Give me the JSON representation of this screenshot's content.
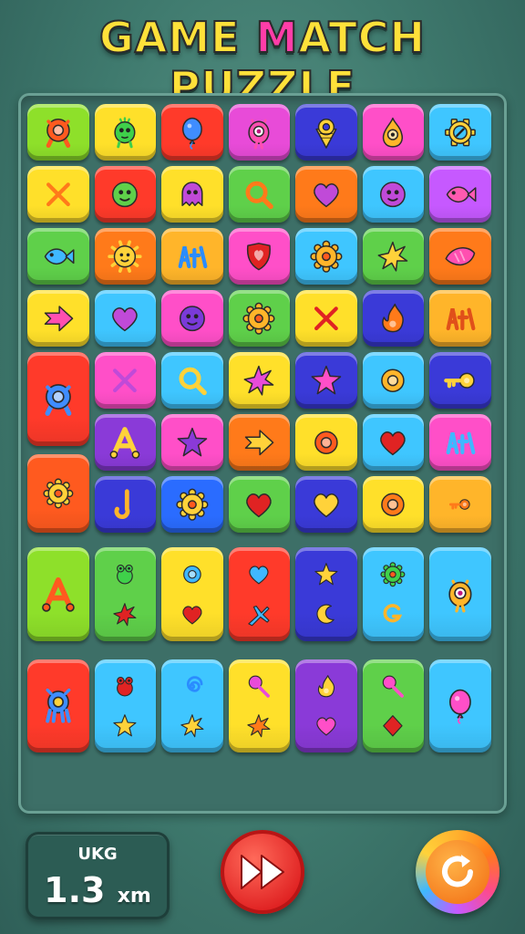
{
  "title": {
    "part1": "GAME ",
    "part2": "M",
    "part3": "ATCH PUZZLE"
  },
  "hud": {
    "label": "UKG",
    "value": "1.3",
    "unit": "xm"
  },
  "tiles": [
    {
      "r": 0,
      "c": 0,
      "color": "#8ee02a",
      "icon": "ring-creature-icon",
      "ic": "#ff5a1f"
    },
    {
      "r": 0,
      "c": 1,
      "color": "#ffe02a",
      "icon": "alien-creature-icon",
      "ic": "#3fd04a"
    },
    {
      "r": 0,
      "c": 2,
      "color": "#ff3a2a",
      "icon": "balloon-creature-icon",
      "ic": "#3f8dff"
    },
    {
      "r": 0,
      "c": 3,
      "color": "#e84bd8",
      "icon": "eye-creature-icon",
      "ic": "#ff4fb0"
    },
    {
      "r": 0,
      "c": 4,
      "color": "#3a3ad8",
      "icon": "cone-creature-icon",
      "ic": "#ffd23a"
    },
    {
      "r": 0,
      "c": 5,
      "color": "#ff4fc8",
      "icon": "flame-creature-icon",
      "ic": "#ffb52a"
    },
    {
      "r": 0,
      "c": 6,
      "color": "#3fc6ff",
      "icon": "gear-compass-icon",
      "ic": "#ffd23a"
    },
    {
      "r": 1,
      "c": 0,
      "color": "#ffe02a",
      "icon": "cross-icon",
      "ic": "#ff7a1a"
    },
    {
      "r": 1,
      "c": 1,
      "color": "#ff3a2a",
      "icon": "face-icon",
      "ic": "#5fd04a"
    },
    {
      "r": 1,
      "c": 2,
      "color": "#ffe02a",
      "icon": "ghost-icon",
      "ic": "#c04ad8"
    },
    {
      "r": 1,
      "c": 3,
      "color": "#5fd04a",
      "icon": "magnifier-icon",
      "ic": "#ff7a1a"
    },
    {
      "r": 1,
      "c": 4,
      "color": "#ff7a1a",
      "icon": "heart-icon",
      "ic": "#c04ad8"
    },
    {
      "r": 1,
      "c": 5,
      "color": "#3fc6ff",
      "icon": "face-icon",
      "ic": "#c04ad8"
    },
    {
      "r": 1,
      "c": 6,
      "color": "#c659ff",
      "icon": "fish-icon",
      "ic": "#ff5ab0"
    },
    {
      "r": 2,
      "c": 0,
      "color": "#5fd04a",
      "icon": "fish-icon",
      "ic": "#3fb8ff"
    },
    {
      "r": 2,
      "c": 1,
      "color": "#ff7a1a",
      "icon": "sun-face-icon",
      "ic": "#ffd23a"
    },
    {
      "r": 2,
      "c": 2,
      "color": "#ffb52a",
      "icon": "letters-icon",
      "ic": "#2a8cff"
    },
    {
      "r": 2,
      "c": 3,
      "color": "#ff4fc8",
      "icon": "shield-heart-icon",
      "ic": "#e02323"
    },
    {
      "r": 2,
      "c": 4,
      "color": "#3fc6ff",
      "icon": "gear-icon",
      "ic": "#ffb52a"
    },
    {
      "r": 2,
      "c": 5,
      "color": "#5fd04a",
      "icon": "star-burst-icon",
      "ic": "#ffd23a"
    },
    {
      "r": 2,
      "c": 6,
      "color": "#ff7a1a",
      "icon": "leaf-icon",
      "ic": "#ff4fb0"
    },
    {
      "r": 3,
      "c": 0,
      "color": "#ffe02a",
      "icon": "arrow-icon",
      "ic": "#ff4fb0"
    },
    {
      "r": 3,
      "c": 1,
      "color": "#3fc6ff",
      "icon": "heart-icon",
      "ic": "#c04ad8"
    },
    {
      "r": 3,
      "c": 2,
      "color": "#ff4fc8",
      "icon": "blob-face-icon",
      "ic": "#7a3ad8"
    },
    {
      "r": 3,
      "c": 3,
      "color": "#5fd04a",
      "icon": "gear-icon",
      "ic": "#ffb52a"
    },
    {
      "r": 3,
      "c": 4,
      "color": "#ffe02a",
      "icon": "cross-icon",
      "ic": "#e02323"
    },
    {
      "r": 3,
      "c": 5,
      "color": "#3a3ad8",
      "icon": "flame-icon",
      "ic": "#ff7a1a"
    },
    {
      "r": 3,
      "c": 6,
      "color": "#ffb52a",
      "icon": "letters-icon",
      "ic": "#e0501a"
    },
    {
      "r": 4,
      "c": 1,
      "color": "#ff4fc8",
      "icon": "cross-icon",
      "ic": "#c04ad8"
    },
    {
      "r": 4,
      "c": 2,
      "color": "#3fc6ff",
      "icon": "magnifier-icon",
      "ic": "#ffd23a"
    },
    {
      "r": 4,
      "c": 3,
      "color": "#ffe02a",
      "icon": "star-burst-icon",
      "ic": "#e84bd8"
    },
    {
      "r": 4,
      "c": 4,
      "color": "#3a3ad8",
      "icon": "star-icon",
      "ic": "#ff4fc8"
    },
    {
      "r": 4,
      "c": 5,
      "color": "#3fc6ff",
      "icon": "ring-icon",
      "ic": "#ffb52a"
    },
    {
      "r": 4,
      "c": 6,
      "color": "#3a3ad8",
      "icon": "key-icon",
      "ic": "#ffd23a"
    },
    {
      "r": 5,
      "c": 1,
      "color": "#8a3ad8",
      "icon": "letter-a-icon",
      "ic": "#ffd23a"
    },
    {
      "r": 5,
      "c": 2,
      "color": "#ff4fc8",
      "icon": "star-icon",
      "ic": "#8a3ad8"
    },
    {
      "r": 5,
      "c": 3,
      "color": "#ff7a1a",
      "icon": "arrow-icon",
      "ic": "#ffd23a"
    },
    {
      "r": 5,
      "c": 4,
      "color": "#ffe02a",
      "icon": "ring-icon",
      "ic": "#ff5a1f"
    },
    {
      "r": 5,
      "c": 5,
      "color": "#3fc6ff",
      "icon": "heart-icon",
      "ic": "#e02323"
    },
    {
      "r": 5,
      "c": 6,
      "color": "#ff4fc8",
      "icon": "letters-icon",
      "ic": "#3fb8ff"
    },
    {
      "r": 6,
      "c": 1,
      "color": "#3a3ad8",
      "icon": "hook-icon",
      "ic": "#ffb52a"
    },
    {
      "r": 6,
      "c": 2,
      "color": "#2a6cff",
      "icon": "gear-icon",
      "ic": "#ffd23a"
    },
    {
      "r": 6,
      "c": 3,
      "color": "#5fd04a",
      "icon": "heart-icon",
      "ic": "#e02323"
    },
    {
      "r": 6,
      "c": 4,
      "color": "#3a3ad8",
      "icon": "heart-icon",
      "ic": "#ffd23a"
    },
    {
      "r": 6,
      "c": 5,
      "color": "#ffe02a",
      "icon": "ring-icon",
      "ic": "#ff7a1a"
    }
  ],
  "bigTiles": [
    {
      "r": 4,
      "c": 0,
      "rows": 1.6,
      "color": "#ff3a2a",
      "icon": "ring-creature-icon",
      "ic": "#3f8dff"
    },
    {
      "r": 5.65,
      "c": 0,
      "rows": 1.35,
      "color": "#ff5a1f",
      "icon": "gear-icon",
      "ic": "#ffd23a"
    },
    {
      "r": 6,
      "c": 6,
      "rows": 1,
      "color": "#ffb52a",
      "icon": "key-icon",
      "ic": "#ff7a1a"
    },
    {
      "r": 7.15,
      "c": 0,
      "rows": 1.6,
      "color": "#8ee02a",
      "icon": "letter-a-icon",
      "ic": "#ff5a1f"
    },
    {
      "r": 7.15,
      "c": 6,
      "rows": 1.6,
      "color": "#3fc6ff",
      "icon": "eye-creature-icon",
      "ic": "#ffb52a"
    },
    {
      "r": 8.95,
      "c": 0,
      "rows": 1.6,
      "color": "#ff3a2a",
      "icon": "squid-icon",
      "ic": "#3f8dff"
    },
    {
      "r": 8.95,
      "c": 6,
      "rows": 1.6,
      "color": "#3fc6ff",
      "icon": "balloon-creature-icon",
      "ic": "#ff4fc8"
    }
  ],
  "twinTiles": [
    {
      "r": 7.15,
      "c": 1,
      "color": "#5fd04a",
      "icons": [
        "frog-icon",
        "star-burst-icon"
      ],
      "ic": [
        "#3fd04a",
        "#e02323"
      ]
    },
    {
      "r": 7.15,
      "c": 2,
      "color": "#ffe02a",
      "icons": [
        "ring-icon",
        "heart-icon"
      ],
      "ic": [
        "#3fb8ff",
        "#e02323"
      ]
    },
    {
      "r": 7.15,
      "c": 3,
      "color": "#ff3a2a",
      "icons": [
        "heart-icon",
        "plane-icon"
      ],
      "ic": [
        "#3fb8ff",
        "#3fb8ff"
      ]
    },
    {
      "r": 7.15,
      "c": 4,
      "color": "#3a3ad8",
      "icons": [
        "star-icon",
        "moon-icon"
      ],
      "ic": [
        "#ffd23a",
        "#ffd23a"
      ]
    },
    {
      "r": 7.15,
      "c": 5,
      "color": "#3fc6ff",
      "icons": [
        "gear-icon",
        "letter-g-icon"
      ],
      "ic": [
        "#3fd04a",
        "#ffb52a"
      ]
    },
    {
      "r": 8.95,
      "c": 1,
      "color": "#3fc6ff",
      "icons": [
        "frog-icon",
        "star-icon"
      ],
      "ic": [
        "#e02323",
        "#ffd23a"
      ]
    },
    {
      "r": 8.95,
      "c": 2,
      "color": "#3fc6ff",
      "icons": [
        "swirl-icon",
        "star-burst-icon"
      ],
      "ic": [
        "#2a8cff",
        "#ffd23a"
      ]
    },
    {
      "r": 8.95,
      "c": 3,
      "color": "#ffe02a",
      "icons": [
        "lollipop-icon",
        "star-burst-icon"
      ],
      "ic": [
        "#e84bd8",
        "#ff7a1a"
      ]
    },
    {
      "r": 8.95,
      "c": 4,
      "color": "#8a3ad8",
      "icons": [
        "flame-icon",
        "heart-icon"
      ],
      "ic": [
        "#ffd23a",
        "#ff4fc8"
      ]
    },
    {
      "r": 8.95,
      "c": 5,
      "color": "#5fd04a",
      "icons": [
        "lollipop-icon",
        "diamond-icon"
      ],
      "ic": [
        "#ff4fc8",
        "#e02323"
      ]
    }
  ]
}
